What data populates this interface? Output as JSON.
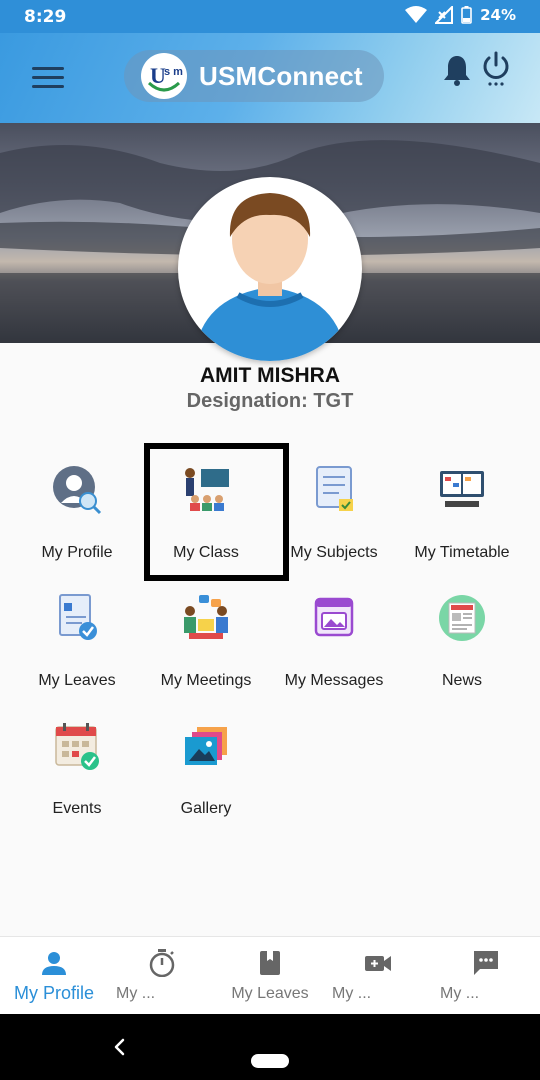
{
  "status_bar": {
    "time": "8:29",
    "battery": "24%"
  },
  "app_bar": {
    "title": "USMConnect",
    "logo_text": "usm"
  },
  "profile": {
    "name": "AMIT MISHRA",
    "designation": "Designation: TGT"
  },
  "menu": [
    {
      "label": "My Profile",
      "icon": "profile-icon"
    },
    {
      "label": "My Class",
      "icon": "class-icon"
    },
    {
      "label": "My Subjects",
      "icon": "subjects-icon"
    },
    {
      "label": "My Timetable",
      "icon": "timetable-icon"
    },
    {
      "label": "My Leaves",
      "icon": "leaves-icon"
    },
    {
      "label": "My Meetings",
      "icon": "meetings-icon"
    },
    {
      "label": "My Messages",
      "icon": "messages-icon"
    },
    {
      "label": "News",
      "icon": "news-icon"
    },
    {
      "label": "Events",
      "icon": "events-icon"
    },
    {
      "label": "Gallery",
      "icon": "gallery-icon"
    }
  ],
  "bottom_nav": [
    {
      "label": "My Profile",
      "icon": "person-icon",
      "active": true
    },
    {
      "label": "My ...",
      "icon": "stopwatch-icon",
      "active": false
    },
    {
      "label": "My Leaves",
      "icon": "book-icon",
      "active": false
    },
    {
      "label": "My ...",
      "icon": "video-camera-icon",
      "active": false
    },
    {
      "label": "My ...",
      "icon": "chat-icon",
      "active": false
    }
  ],
  "colors": {
    "accent": "#2b8fd8",
    "status_bar": "#2f8fd8"
  }
}
